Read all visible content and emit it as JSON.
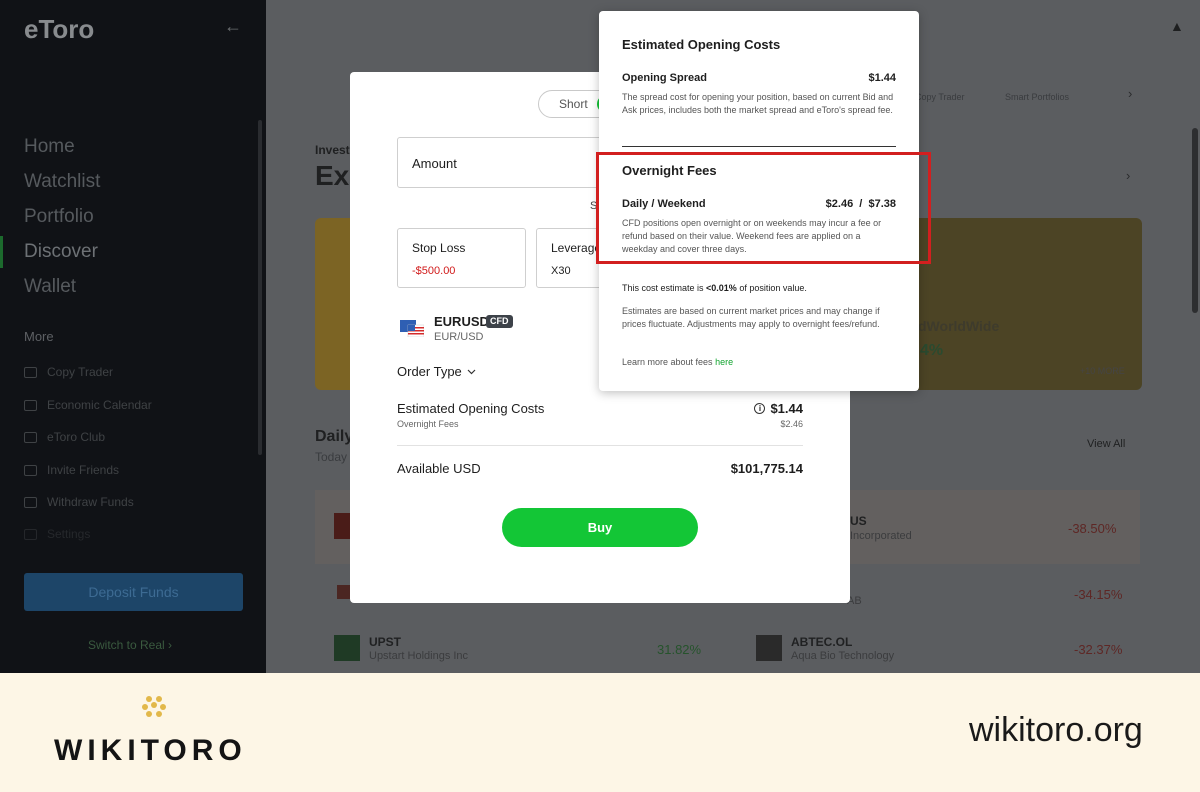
{
  "sidebar": {
    "logo": "eToro",
    "username": "",
    "nav": [
      "Home",
      "Watchlist",
      "Portfolio",
      "Discover",
      "Wallet"
    ],
    "more_label": "More",
    "sub_items": [
      "Copy Trader",
      "Economic Calendar",
      "eToro Club",
      "Invite Friends",
      "Withdraw Funds",
      "Settings"
    ],
    "deposit_label": "Deposit Funds",
    "switch_label": "Switch to Real ›"
  },
  "background": {
    "invest_label": "Invest",
    "explore_label": "Exp",
    "card_text": "dWorldWide",
    "card_pct": "4%",
    "card_more": "+10 MORE",
    "tab_copy": "Copy Trader",
    "tab_smart": "Smart Portfolios",
    "daily_label": "Daily",
    "today_label": "Today",
    "view_all": "View All",
    "rows": [
      {
        "ticker": "",
        "sub": "",
        "right_ticker": "US",
        "right_sub": "Incorporated",
        "right_change": "-38.50%"
      },
      {
        "ticker": "",
        "sub": "",
        "right_ticker": "",
        "right_sub": "AB",
        "right_change": "-34.15%"
      },
      {
        "ticker": "UPST",
        "sub": "Upstart Holdings Inc",
        "change": "31.82%",
        "right_ticker": "ABTEC.OL",
        "right_sub": "Aqua Bio Technology",
        "right_change": "-32.37%"
      }
    ]
  },
  "modal": {
    "toggle_short": "Short",
    "amount_label": "Amount",
    "s_letter": "S",
    "stop_loss_label": "Stop Loss",
    "stop_loss_value": "-$500.00",
    "leverage_label": "Leverage",
    "leverage_value": "X30",
    "pair": "EURUSD",
    "pair_badge": "CFD",
    "pair_sub": "EUR/USD",
    "order_type": "Order Type",
    "est_costs_label": "Estimated Opening Costs",
    "est_costs_sub": "Overnight Fees",
    "est_costs_value": "$1.44",
    "est_costs_sub_value": "$2.46",
    "available_label": "Available USD",
    "available_value": "$101,775.14",
    "buy_label": "Buy"
  },
  "popover": {
    "title": "Estimated Opening Costs",
    "spread_label": "Opening Spread",
    "spread_value": "$1.44",
    "spread_desc": "The spread cost for opening your position, based on current Bid and Ask prices, includes both the market spread and eToro's spread fee.",
    "overnight_title": "Overnight Fees",
    "daily_label": "Daily / Weekend",
    "daily_value": "$2.46  /  $7.38",
    "overnight_desc": "CFD positions open overnight or on weekends may incur a fee or refund based on their value. Weekend fees are applied on a weekday and cover three days.",
    "estimate_note_prefix": "This cost estimate is ",
    "estimate_note_bold": "<0.01%",
    "estimate_note_suffix": " of position value.",
    "disclaimer": "Estimates are based on current market prices and may change if prices fluctuate. Adjustments may apply to overnight fees/refund.",
    "learn_more": "Learn more about fees ",
    "learn_more_link": "here"
  },
  "watermark": {
    "brand": "WIKITORO",
    "url": "wikitoro.org"
  },
  "colors": {
    "accent_green": "#13c636",
    "loss_red": "#d11a1a",
    "highlight_red": "#d21f1f",
    "sidebar_bg": "#101216"
  }
}
